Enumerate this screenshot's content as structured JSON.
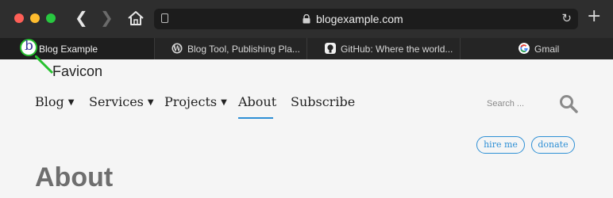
{
  "browser": {
    "url": "blogexample.com",
    "tabs": [
      {
        "label": "Blog Example",
        "favicon": "b"
      },
      {
        "label": "Blog Tool, Publishing Pla...",
        "favicon": "wordpress-icon"
      },
      {
        "label": "GitHub: Where the world...",
        "favicon": "github-icon"
      },
      {
        "label": "Gmail",
        "favicon": "google-icon"
      }
    ]
  },
  "annotation": {
    "label": "Favicon",
    "color": "#27c12f"
  },
  "site": {
    "nav": [
      {
        "label": "Blog"
      },
      {
        "label": "Services"
      },
      {
        "label": "Projects"
      },
      {
        "label": "About"
      },
      {
        "label": "Subscribe"
      }
    ],
    "search_placeholder": "Search ...",
    "buttons": {
      "hire": "hire me",
      "donate": "donate"
    },
    "page_heading": "About",
    "accent_color": "#2d8fd5"
  }
}
